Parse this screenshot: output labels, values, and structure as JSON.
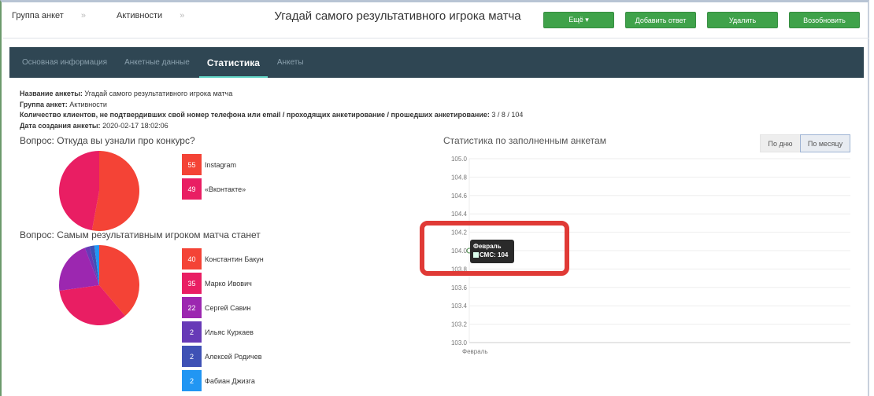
{
  "breadcrumb": [
    "Группа анкет",
    "Активности"
  ],
  "header": {
    "title": "Угадай самого результативного игрока матча"
  },
  "buttons": {
    "more": "Ещё ▾",
    "add_answer": "Добавить ответ",
    "delete": "Удалить",
    "resume": "Возобновить"
  },
  "tabs": [
    "Основная информация",
    "Анкетные данные",
    "Статистика",
    "Анкеты"
  ],
  "info": {
    "name_label": "Название анкеты:",
    "name": "Угадай самого результативного игрока матча",
    "group_label": "Группа анкет:",
    "group": "Активности",
    "count_label": "Количество клиентов, не подтвердивших свой номер телефона или email / проходящих анкетирование / прошедших анкетирование:",
    "count": "3 / 8 / 104",
    "date_label": "Дата создания анкеты:",
    "date": "2020-02-17 18:02:06"
  },
  "chart_data": [
    {
      "type": "pie",
      "title": "Вопрос: Откуда вы узнали про конкурс?",
      "categories": [
        "Instagram",
        "«Вконтакте»"
      ],
      "values": [
        55,
        49
      ],
      "colors": [
        "#f44336",
        "#e91e63"
      ]
    },
    {
      "type": "pie",
      "title": "Вопрос: Самым результативным игроком матча станет",
      "categories": [
        "Константин Бакун",
        "Марко Ивович",
        "Сергей Савин",
        "Ильяс Куркаев",
        "Алексей Родичев",
        "Фабиан Джизга"
      ],
      "values": [
        40,
        35,
        22,
        2,
        2,
        2
      ],
      "colors": [
        "#f44336",
        "#e91e63",
        "#9c27b0",
        "#673ab7",
        "#3f51b5",
        "#2196f3"
      ]
    },
    {
      "type": "line",
      "title": "Статистика по заполненным анкетам",
      "x": [
        "Февраль"
      ],
      "series": [
        {
          "name": "СМС",
          "values": [
            104
          ]
        }
      ],
      "ylim": [
        103.0,
        105.0
      ],
      "yticks": [
        "105.0",
        "104.8",
        "104.6",
        "104.4",
        "104.2",
        "104.0",
        "103.8",
        "103.6",
        "103.4",
        "103.2",
        "103.0"
      ],
      "grid": true,
      "tooltip": {
        "title": "Февраль",
        "label": "СМС: 104"
      }
    }
  ],
  "toggle": {
    "day": "По дню",
    "month": "По месяцу"
  }
}
